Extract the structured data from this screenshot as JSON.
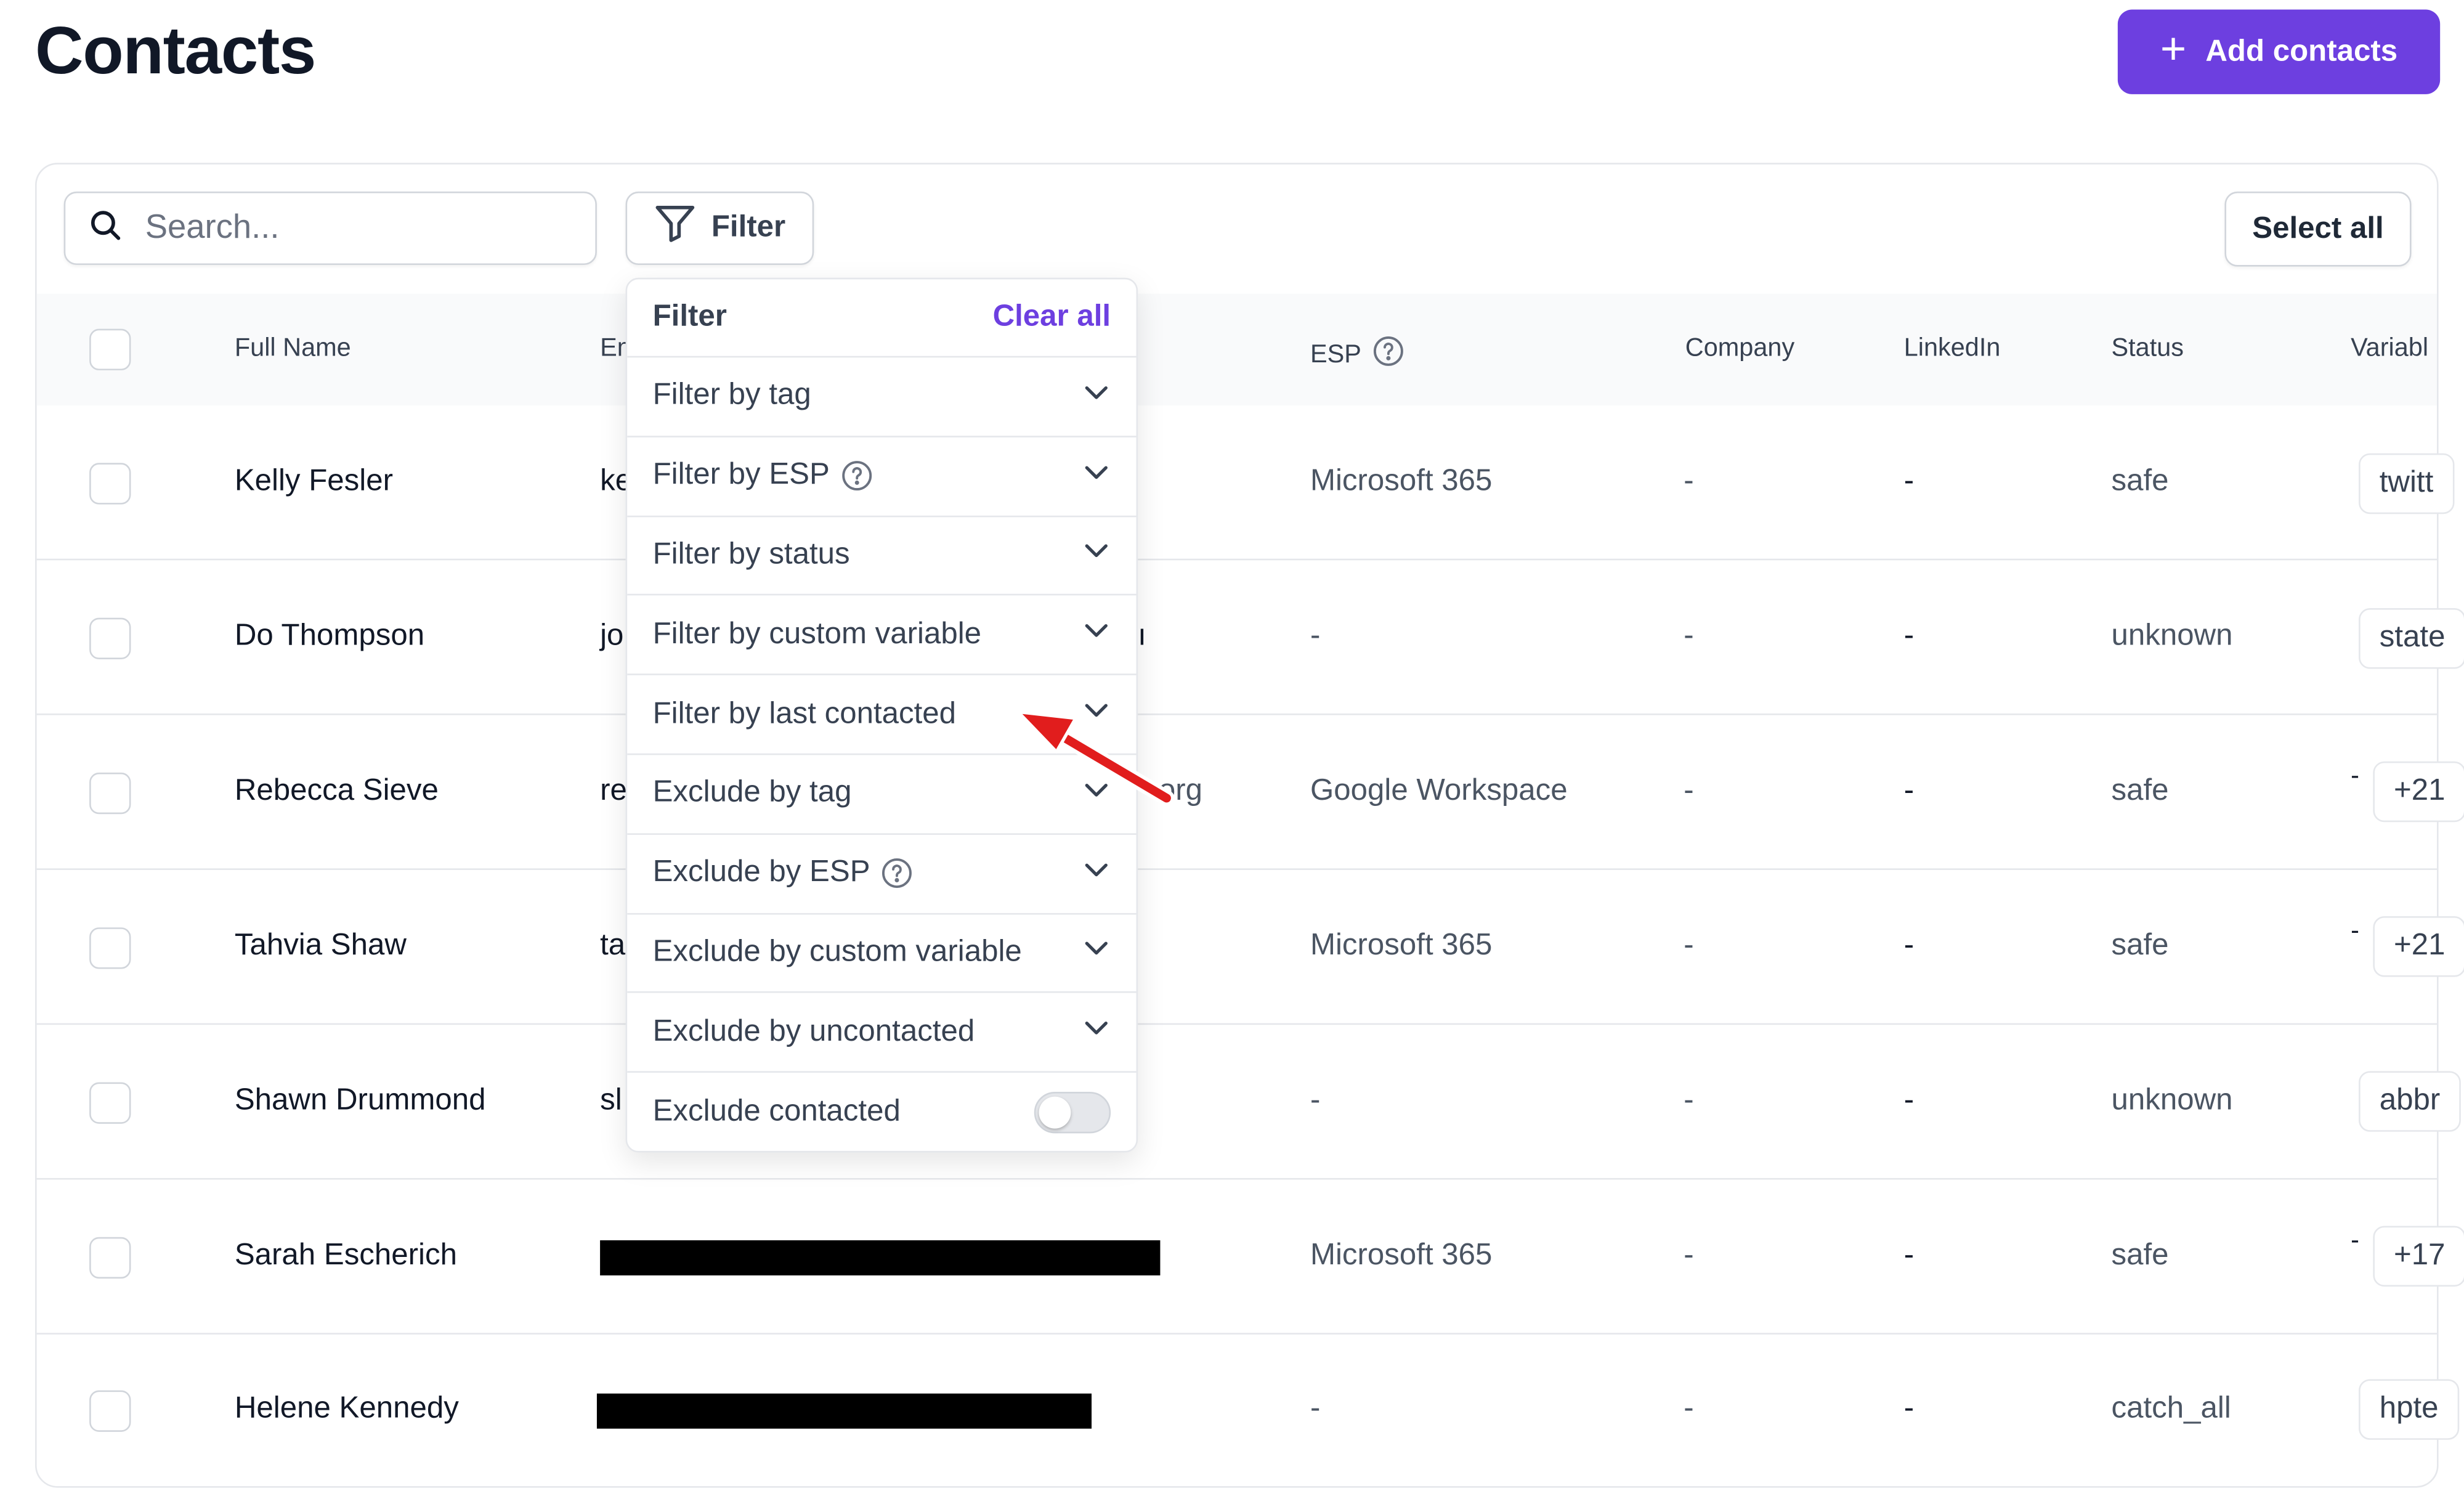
{
  "page": {
    "title": "Contacts",
    "add_button": "Add contacts"
  },
  "toolbar": {
    "search_placeholder": "Search...",
    "filter_label": "Filter",
    "select_all": "Select all"
  },
  "table": {
    "columns": [
      "Full Name",
      "Em",
      "ESP",
      "Company",
      "LinkedIn",
      "Status",
      "Variabl"
    ],
    "rows": [
      {
        "name": "Kelly Fesler",
        "email": "ke",
        "esp": "Microsoft 365",
        "company": "-",
        "linkedin": "-",
        "status": "safe",
        "variable": "twitt",
        "variable_prefix": ""
      },
      {
        "name": "Do Thompson",
        "email": "jo",
        "email_tail": "ı",
        "esp": "-",
        "company": "-",
        "linkedin": "-",
        "status": "unknown",
        "variable": "state",
        "variable_prefix": ""
      },
      {
        "name": "Rebecca Sieve",
        "email": "re",
        "email_tail": "org",
        "esp": "Google Workspace",
        "company": "-",
        "linkedin": "-",
        "status": "safe",
        "variable": "+21",
        "variable_prefix": "-"
      },
      {
        "name": "Tahvia Shaw",
        "email": "ta",
        "esp": "Microsoft 365",
        "company": "-",
        "linkedin": "-",
        "status": "safe",
        "variable": "+21",
        "variable_prefix": "-"
      },
      {
        "name": "Shawn Drummond",
        "email": "sl",
        "esp": "-",
        "company": "-",
        "linkedin": "-",
        "status": "unknown",
        "variable": "abbr",
        "variable_prefix": ""
      },
      {
        "name": "Sarah Escherich",
        "email": "",
        "esp": "Microsoft 365",
        "company": "-",
        "linkedin": "-",
        "status": "safe",
        "variable": "+17",
        "variable_prefix": "-"
      },
      {
        "name": "Helene Kennedy",
        "email": "",
        "esp": "-",
        "company": "-",
        "linkedin": "-",
        "status": "catch_all",
        "variable": "hpte",
        "variable_prefix": ""
      }
    ]
  },
  "filter_menu": {
    "title": "Filter",
    "clear_all": "Clear all",
    "items": [
      {
        "label": "Filter by tag",
        "icon": "chevron-down-icon"
      },
      {
        "label": "Filter by ESP",
        "icon": "chevron-down-icon",
        "help": true
      },
      {
        "label": "Filter by status",
        "icon": "chevron-down-icon"
      },
      {
        "label": "Filter by custom variable",
        "icon": "chevron-down-icon"
      },
      {
        "label": "Filter by last contacted",
        "icon": "chevron-down-icon"
      },
      {
        "label": "Exclude by tag",
        "icon": "chevron-down-icon"
      },
      {
        "label": "Exclude by ESP",
        "icon": "chevron-down-icon",
        "help": true
      },
      {
        "label": "Exclude by custom variable",
        "icon": "chevron-down-icon"
      },
      {
        "label": "Exclude by uncontacted",
        "icon": "chevron-down-icon"
      },
      {
        "label": "Exclude contacted",
        "icon": "toggle",
        "toggle_on": false
      }
    ]
  },
  "colors": {
    "accent": "#6d3fe0",
    "annotation_arrow": "#e11d1d"
  }
}
